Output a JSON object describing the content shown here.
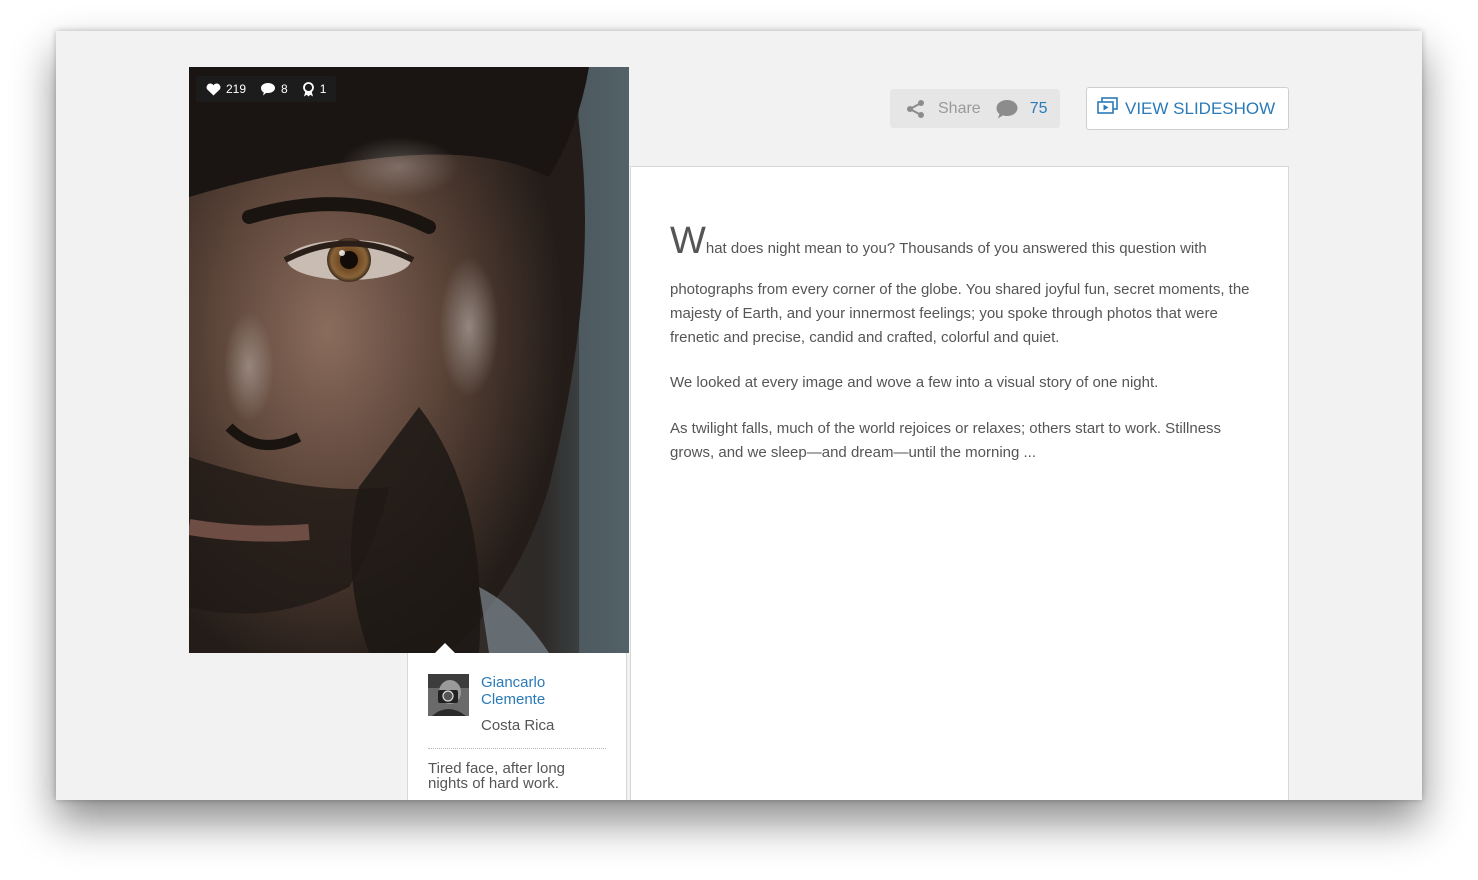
{
  "photo": {
    "stats": {
      "likes": "219",
      "comments": "8",
      "awards": "1"
    }
  },
  "caption": {
    "author_name": "Giancarlo Clemente",
    "location": "Costa Rica",
    "text": "Tired face, after long nights of hard work."
  },
  "toolbar": {
    "share_label": "Share",
    "comment_count": "75",
    "slideshow_label": "VIEW SLIDESHOW"
  },
  "article": {
    "dropcap": "W",
    "first_line": "hat does night mean to you? Thousands of you answered this question with",
    "p1_rest": "photographs from every corner of the globe. You shared joyful fun, secret moments, the majesty of Earth, and your innermost feelings; you spoke through photos that were frenetic and precise, candid and crafted, colorful and quiet.",
    "p2": "We looked at every image and wove a few into a visual story of one night.",
    "p3": "As twilight falls, much of the world rejoices or relaxes; others start to work. Stillness grows, and we sleep—and dream—until the morning ..."
  },
  "colors": {
    "link": "#2a7ab8",
    "background": "#f2f2f2",
    "text": "#555555"
  }
}
